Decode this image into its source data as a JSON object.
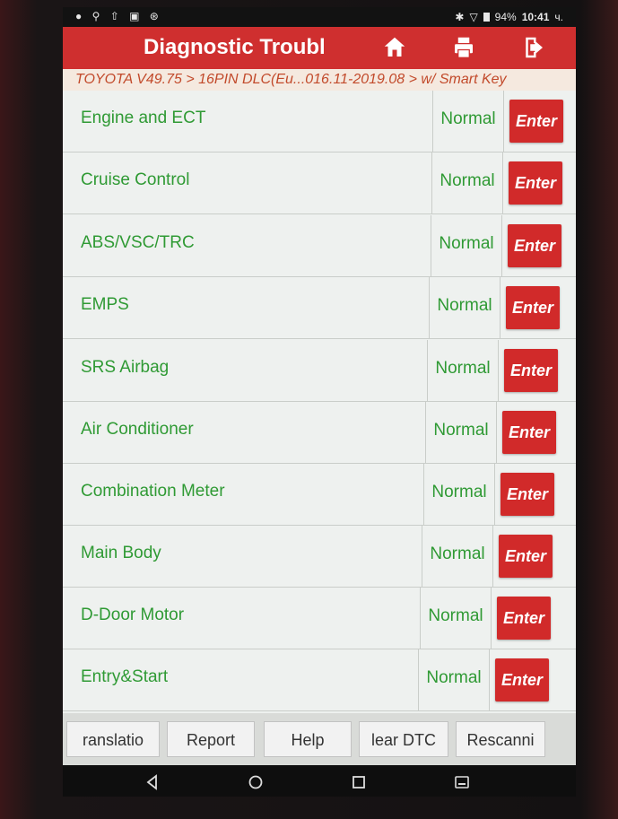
{
  "status_bar": {
    "battery": "94%",
    "time": "10:41",
    "suffix": "ч."
  },
  "header": {
    "title": "Diagnostic Troubl",
    "accent_color": "#cf2f2f",
    "icons": [
      "home-icon",
      "print-icon",
      "exit-icon"
    ]
  },
  "breadcrumb": "TOYOTA V49.75 > 16PIN DLC(Eu...016.11-2019.08 > w/ Smart Key",
  "systems": [
    {
      "name": "Engine and ECT",
      "status": "Normal",
      "action": "Enter"
    },
    {
      "name": "Cruise Control",
      "status": "Normal",
      "action": "Enter"
    },
    {
      "name": "ABS/VSC/TRC",
      "status": "Normal",
      "action": "Enter"
    },
    {
      "name": "EMPS",
      "status": "Normal",
      "action": "Enter"
    },
    {
      "name": "SRS Airbag",
      "status": "Normal",
      "action": "Enter"
    },
    {
      "name": "Air Conditioner",
      "status": "Normal",
      "action": "Enter"
    },
    {
      "name": "Combination Meter",
      "status": "Normal",
      "action": "Enter"
    },
    {
      "name": "Main Body",
      "status": "Normal",
      "action": "Enter"
    },
    {
      "name": "D-Door Motor",
      "status": "Normal",
      "action": "Enter"
    },
    {
      "name": "Entry&Start",
      "status": "Normal",
      "action": "Enter"
    }
  ],
  "toolbar": {
    "translation": "ranslatio",
    "report": "Report",
    "help": "Help",
    "clear_dtc": "lear DTC",
    "rescan": "Rescanni"
  },
  "nav_icons": [
    "back-icon",
    "home-circle-icon",
    "recents-icon",
    "keyboard-icon"
  ]
}
